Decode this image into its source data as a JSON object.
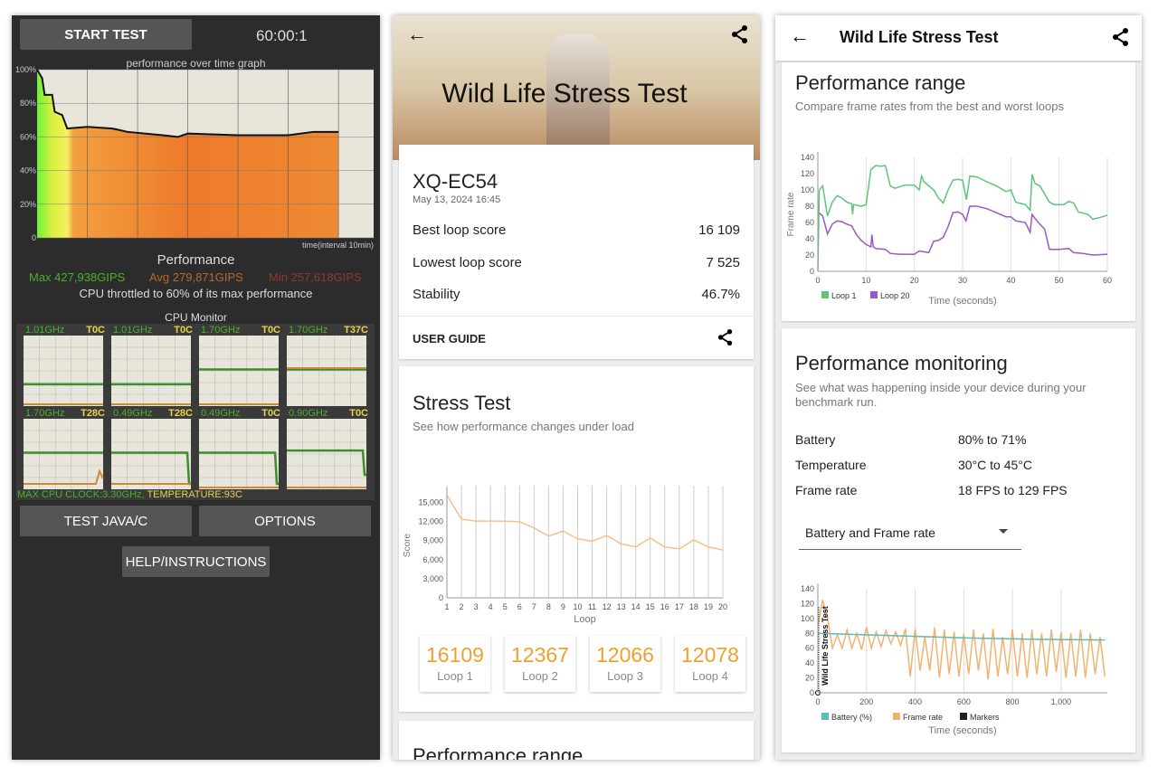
{
  "left": {
    "start_button": "START TEST",
    "timer": "60:00:1",
    "graph": {
      "title": "performance over time graph",
      "y_ticks": [
        "100%",
        "80%",
        "60%",
        "40%",
        "20%",
        "0"
      ],
      "x_label": "time(interval 10min)",
      "points": [
        [
          0,
          100
        ],
        [
          1,
          95
        ],
        [
          1.5,
          85
        ],
        [
          3,
          85
        ],
        [
          3.5,
          75
        ],
        [
          5,
          73
        ],
        [
          6,
          65
        ],
        [
          10,
          66
        ],
        [
          15,
          65
        ],
        [
          18,
          63
        ],
        [
          25,
          61
        ],
        [
          28,
          60
        ],
        [
          30,
          62
        ],
        [
          40,
          61
        ],
        [
          50,
          61
        ],
        [
          55,
          63
        ],
        [
          60,
          63
        ]
      ],
      "x_max_min": 67
    },
    "performance_title": "Performance",
    "max": "Max 427,938GIPS",
    "avg": "Avg 279,871GIPS",
    "min": "Min 257,618GIPS",
    "throttle": "CPU throttled to 60% of its max performance",
    "cpu_monitor_title": "CPU Monitor",
    "cores": [
      {
        "freq": "1.01GHz",
        "temp": "T0C",
        "level": 0.31,
        "drop": false
      },
      {
        "freq": "1.01GHz",
        "temp": "T0C",
        "level": 0.31,
        "drop": false
      },
      {
        "freq": "1.70GHz",
        "temp": "T0C",
        "level": 0.52,
        "drop": false
      },
      {
        "freq": "1.70GHz",
        "temp": "T37C",
        "level": 0.52,
        "drop": false
      },
      {
        "freq": "1.70GHz",
        "temp": "T28C",
        "level": 0.52,
        "drop": false
      },
      {
        "freq": "0.49GHz",
        "temp": "T28C",
        "level": 0.52,
        "drop": true
      },
      {
        "freq": "0.49GHz",
        "temp": "T0C",
        "level": 0.52,
        "drop": true
      },
      {
        "freq": "0.90GHz",
        "temp": "T0C",
        "level": 0.55,
        "drop": true
      }
    ],
    "max_clock": "MAX CPU CLOCK:3.30GHz,",
    "temperature": "TEMPERATURE:93C",
    "test_java_button": "TEST JAVA/C",
    "options_button": "OPTIONS",
    "help_button": "HELP/INSTRUCTIONS",
    "colors": {
      "green": "#4caf2a",
      "orange": "#c98a3a",
      "yellow": "#e8d44a"
    }
  },
  "mid": {
    "title": "Wild Life Stress Test",
    "device": "XQ-EC54",
    "date": "May 13, 2024 16:45",
    "stats": [
      {
        "label": "Best loop score",
        "value": "16 109"
      },
      {
        "label": "Lowest loop score",
        "value": "7 525"
      },
      {
        "label": "Stability",
        "value": "46.7%"
      }
    ],
    "user_guide": "USER GUIDE",
    "stress_title": "Stress Test",
    "stress_sub": "See how performance changes under load",
    "loops": [
      {
        "score": "16109",
        "label": "Loop 1"
      },
      {
        "score": "12367",
        "label": "Loop 2"
      },
      {
        "score": "12066",
        "label": "Loop 3"
      },
      {
        "score": "12078",
        "label": "Loop 4"
      }
    ],
    "next_card_title": "Performance range"
  },
  "right": {
    "title": "Wild Life Stress Test",
    "range_title": "Performance range",
    "range_sub": "Compare frame rates from the best and worst loops",
    "monitor_title": "Performance monitoring",
    "monitor_sub": "See what was happening inside your device during your benchmark run.",
    "monitor_rows": [
      {
        "label": "Battery",
        "value": "80% to 71%"
      },
      {
        "label": "Temperature",
        "value": "30°C to 45°C"
      },
      {
        "label": "Frame rate",
        "value": "18 FPS to 129 FPS"
      }
    ],
    "dropdown": "Battery and Frame rate"
  },
  "chart_data": [
    {
      "type": "line",
      "xlabel": "Loop",
      "ylabel": "Score",
      "ylim": [
        0,
        16500
      ],
      "y_ticks": [
        "0",
        "3,000",
        "6,000",
        "9,000",
        "12,000",
        "15,000"
      ],
      "categories": [
        "1",
        "2",
        "3",
        "4",
        "5",
        "6",
        "7",
        "8",
        "9",
        "10",
        "11",
        "12",
        "13",
        "14",
        "15",
        "16",
        "17",
        "18",
        "19",
        "20"
      ],
      "values": [
        16109,
        12367,
        12066,
        12078,
        12050,
        11980,
        11000,
        9700,
        10500,
        9300,
        8900,
        9800,
        8500,
        8000,
        9400,
        8000,
        7700,
        9100,
        8000,
        7525
      ],
      "color": "#f5c08a"
    },
    {
      "type": "line",
      "xlabel": "Time (seconds)",
      "ylabel": "Frame rate",
      "xlim": [
        0,
        60
      ],
      "ylim": [
        0,
        140
      ],
      "x_ticks": [
        "0",
        "10",
        "20",
        "30",
        "40",
        "50",
        "60"
      ],
      "y_ticks": [
        "0",
        "20",
        "40",
        "60",
        "80",
        "100",
        "120",
        "140"
      ],
      "series": [
        {
          "name": "Loop 1",
          "color": "#5cc678",
          "points": [
            [
              0,
              0
            ],
            [
              0.3,
              100
            ],
            [
              1,
              105
            ],
            [
              2,
              68
            ],
            [
              3,
              85
            ],
            [
              4,
              93
            ],
            [
              5,
              90
            ],
            [
              6,
              85
            ],
            [
              7,
              83
            ],
            [
              7.2,
              70
            ],
            [
              7.4,
              82
            ],
            [
              9,
              80
            ],
            [
              10,
              82
            ],
            [
              11,
              125
            ],
            [
              12,
              130
            ],
            [
              13,
              129
            ],
            [
              14,
              130
            ],
            [
              15,
              105
            ],
            [
              16,
              102
            ],
            [
              17,
              104
            ],
            [
              18,
              106
            ],
            [
              20,
              106
            ],
            [
              21,
              100
            ],
            [
              21.5,
              117
            ],
            [
              22,
              110
            ],
            [
              23,
              105
            ],
            [
              24,
              100
            ],
            [
              25,
              90
            ],
            [
              26,
              84
            ],
            [
              27,
              100
            ],
            [
              28,
              112
            ],
            [
              29,
              113
            ],
            [
              30,
              112
            ],
            [
              30.8,
              88
            ],
            [
              31.5,
              117
            ],
            [
              33,
              116
            ],
            [
              35,
              110
            ],
            [
              37,
              105
            ],
            [
              39,
              98
            ],
            [
              40,
              100
            ],
            [
              41,
              85
            ],
            [
              43,
              82
            ],
            [
              44,
              75
            ],
            [
              44.4,
              119
            ],
            [
              45,
              108
            ],
            [
              46,
              105
            ],
            [
              47,
              95
            ],
            [
              48,
              85
            ],
            [
              49,
              82
            ],
            [
              51,
              82
            ],
            [
              52,
              86
            ],
            [
              53,
              84
            ],
            [
              54,
              73
            ],
            [
              56,
              70
            ],
            [
              57,
              64
            ],
            [
              59,
              67
            ],
            [
              60,
              69
            ]
          ]
        },
        {
          "name": "Loop 20",
          "color": "#9b59c0",
          "points": [
            [
              0,
              73
            ],
            [
              1,
              68
            ],
            [
              2,
              46
            ],
            [
              3,
              58
            ],
            [
              4,
              62
            ],
            [
              5,
              61
            ],
            [
              6,
              58
            ],
            [
              7,
              56
            ],
            [
              8,
              45
            ],
            [
              9,
              38
            ],
            [
              10,
              33
            ],
            [
              11,
              30
            ],
            [
              11.2,
              45
            ],
            [
              11.5,
              30
            ],
            [
              12,
              28
            ],
            [
              14,
              27
            ],
            [
              15,
              22
            ],
            [
              17,
              21
            ],
            [
              20,
              21
            ],
            [
              21,
              25
            ],
            [
              23,
              23
            ],
            [
              24,
              37
            ],
            [
              25,
              38
            ],
            [
              26,
              42
            ],
            [
              27,
              55
            ],
            [
              28,
              72
            ],
            [
              29,
              73
            ],
            [
              30,
              70
            ],
            [
              30.7,
              62
            ],
            [
              31.5,
              80
            ],
            [
              33,
              80
            ],
            [
              35,
              77
            ],
            [
              37,
              72
            ],
            [
              39,
              67
            ],
            [
              40,
              67
            ],
            [
              41,
              62
            ],
            [
              43,
              60
            ],
            [
              44,
              48
            ],
            [
              44.4,
              70
            ],
            [
              45,
              65
            ],
            [
              46,
              58
            ],
            [
              47,
              52
            ],
            [
              48,
              27
            ],
            [
              50,
              27
            ],
            [
              52,
              28
            ],
            [
              53,
              23
            ],
            [
              55,
              22
            ],
            [
              57,
              20
            ],
            [
              60,
              21
            ]
          ]
        }
      ]
    },
    {
      "type": "line",
      "xlabel": "Time (seconds)",
      "xlim": [
        0,
        1190
      ],
      "ylim": [
        0,
        140
      ],
      "x_ticks": [
        "0",
        "200",
        "400",
        "600",
        "800",
        "1,000"
      ],
      "y_ticks": [
        "0",
        "20",
        "40",
        "60",
        "80",
        "100",
        "120",
        "140"
      ],
      "annotation": "Wild Life Stress Test",
      "series": [
        {
          "name": "Battery (%)",
          "color": "#5bbcb8",
          "points": [
            [
              0,
              80
            ],
            [
              300,
              77
            ],
            [
              600,
              74
            ],
            [
              900,
              72
            ],
            [
              1180,
              71
            ]
          ]
        },
        {
          "name": "Frame rate",
          "color": "#f2b270",
          "points": [
            [
              0,
              90
            ],
            [
              20,
              125
            ],
            [
              40,
              100
            ],
            [
              60,
              60
            ],
            [
              80,
              78
            ],
            [
              100,
              60
            ],
            [
              120,
              85
            ],
            [
              140,
              60
            ],
            [
              160,
              80
            ],
            [
              180,
              58
            ],
            [
              200,
              88
            ],
            [
              220,
              60
            ],
            [
              240,
              82
            ],
            [
              260,
              62
            ],
            [
              280,
              84
            ],
            [
              300,
              66
            ],
            [
              320,
              82
            ],
            [
              340,
              64
            ],
            [
              360,
              86
            ],
            [
              380,
              22
            ],
            [
              400,
              86
            ],
            [
              420,
              30
            ],
            [
              440,
              75
            ],
            [
              460,
              30
            ],
            [
              480,
              88
            ],
            [
              500,
              20
            ],
            [
              520,
              85
            ],
            [
              540,
              25
            ],
            [
              560,
              82
            ],
            [
              580,
              22
            ],
            [
              600,
              80
            ],
            [
              620,
              25
            ],
            [
              640,
              85
            ],
            [
              660,
              30
            ],
            [
              680,
              80
            ],
            [
              700,
              18
            ],
            [
              720,
              86
            ],
            [
              740,
              22
            ],
            [
              760,
              75
            ],
            [
              780,
              25
            ],
            [
              800,
              85
            ],
            [
              820,
              22
            ],
            [
              840,
              80
            ],
            [
              860,
              20
            ],
            [
              880,
              85
            ],
            [
              900,
              25
            ],
            [
              920,
              80
            ],
            [
              940,
              22
            ],
            [
              960,
              85
            ],
            [
              980,
              28
            ],
            [
              1000,
              82
            ],
            [
              1020,
              20
            ],
            [
              1040,
              80
            ],
            [
              1060,
              22
            ],
            [
              1080,
              85
            ],
            [
              1100,
              20
            ],
            [
              1120,
              80
            ],
            [
              1140,
              25
            ],
            [
              1160,
              75
            ],
            [
              1180,
              22
            ]
          ]
        },
        {
          "name": "Markers",
          "color": "#222222",
          "points": []
        }
      ]
    }
  ]
}
